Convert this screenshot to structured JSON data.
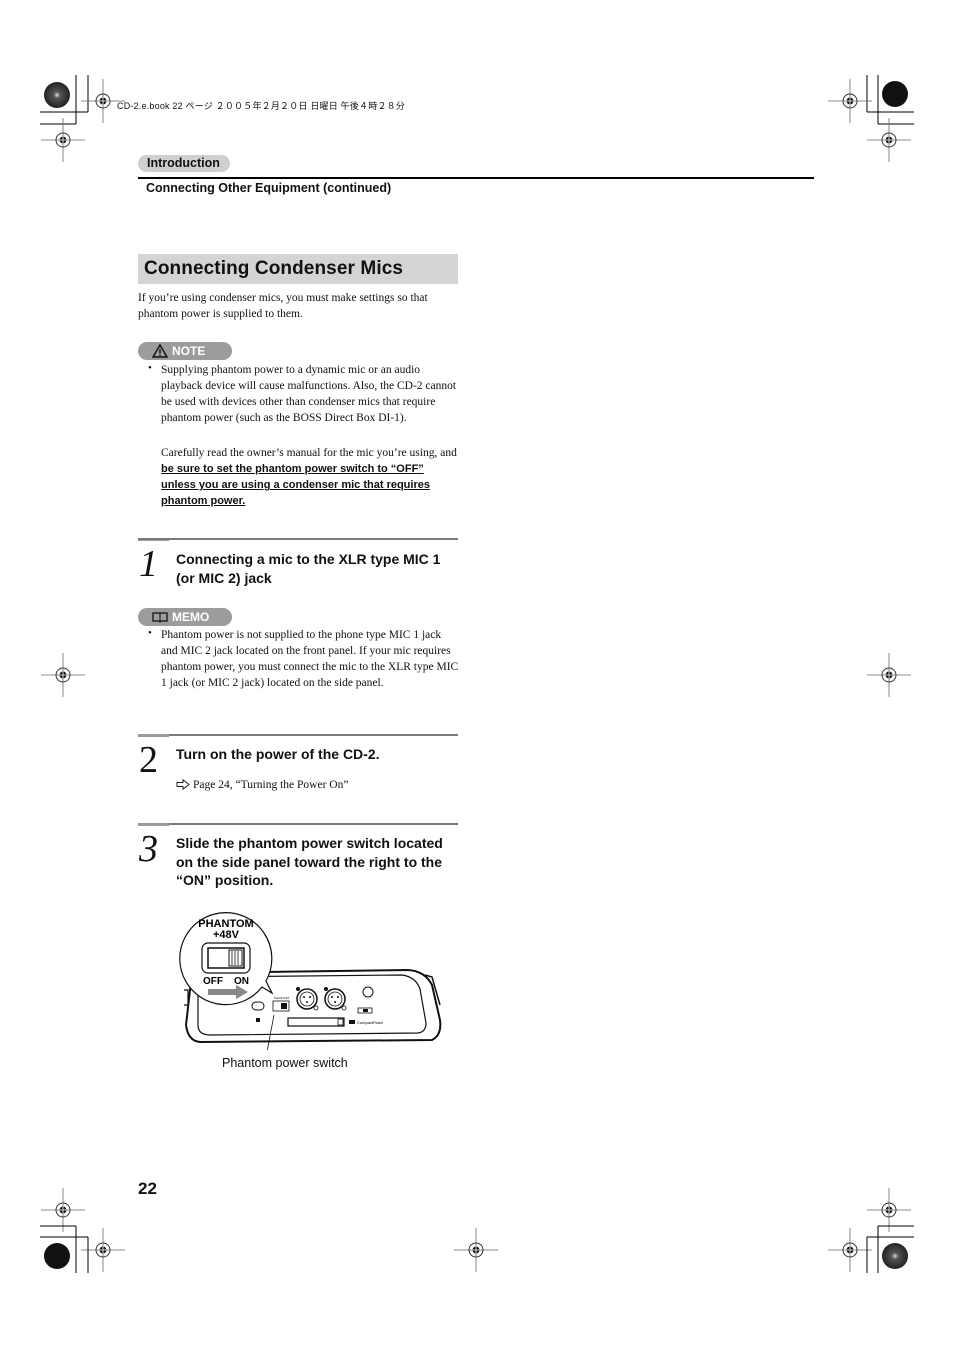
{
  "print_header": {
    "info": "CD-2.e.book  22 ページ  ２００５年２月２０日  日曜日  午後４時２８分"
  },
  "section": {
    "tab_label": "Introduction",
    "subheader": "Connecting Other Equipment (continued)"
  },
  "heading": "Connecting Condenser Mics",
  "intro": "If you’re using condenser mics, you must make settings so that phantom power is supplied to them.",
  "note": {
    "label": "NOTE",
    "icon": "warning-triangle-icon",
    "bullet": "•",
    "item": "Supplying phantom power to a dynamic mic or an audio playback device will cause malfunctions. Also, the CD-2 cannot be used with devices other than condenser mics that require phantom power (such as the BOSS Direct Box DI-1).",
    "para_lead": "Carefully read the owner’s manual for the mic you’re using, and ",
    "para_emphasis": "be sure to set the phantom power switch to “OFF” unless you are using a condenser mic that requires phantom power."
  },
  "steps": [
    {
      "number": "1",
      "title": "Connecting a mic to the XLR type MIC 1 (or MIC 2) jack"
    },
    {
      "number": "2",
      "title": "Turn on the power of the CD-2.",
      "reference": "Page 24, “Turning the Power On”",
      "reference_icon": "arrow-right-icon"
    },
    {
      "number": "3",
      "title": "Slide the phantom power switch located on the side panel toward the right to the “ON” position."
    }
  ],
  "memo": {
    "label": "MEMO",
    "icon": "book-icon",
    "bullet": "•",
    "item": "Phantom power is not supplied to the phone type MIC 1 jack and MIC 2 jack located on the front panel. If your mic requires phantom power, you must connect the mic to the XLR type MIC 1 jack (or MIC 2 jack) located on the side panel."
  },
  "figure": {
    "callout_title": "PHANTOM",
    "callout_voltage": "+48V",
    "switch_off": "OFF",
    "switch_on": "ON",
    "switch_state": "ON",
    "caption": "Phantom power switch"
  },
  "page_number": "22"
}
